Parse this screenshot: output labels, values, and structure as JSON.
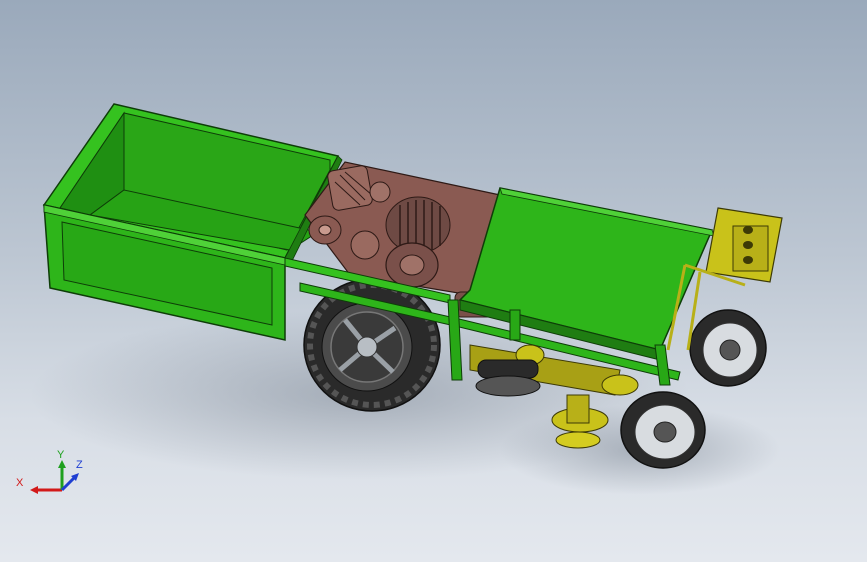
{
  "viewport": {
    "background": "#c7d0db"
  },
  "model": {
    "name": "walking-tractor-trailer-assembly",
    "colors": {
      "frame_green": "#2eb51a",
      "frame_green_dark": "#1f7d12",
      "frame_green_light": "#4fd138",
      "gear_mauve": "#8a5a52",
      "gear_mauve_dark": "#4a2d28",
      "cutter_yellow": "#c9c21a",
      "tire_dark": "#2a2a2a",
      "rim_gray": "#9aa0a6"
    }
  },
  "triad": {
    "x_label": "X",
    "y_label": "Y",
    "z_label": "Z",
    "x_color": "#d21919",
    "y_color": "#1fa01f",
    "z_color": "#1f3fd2"
  }
}
